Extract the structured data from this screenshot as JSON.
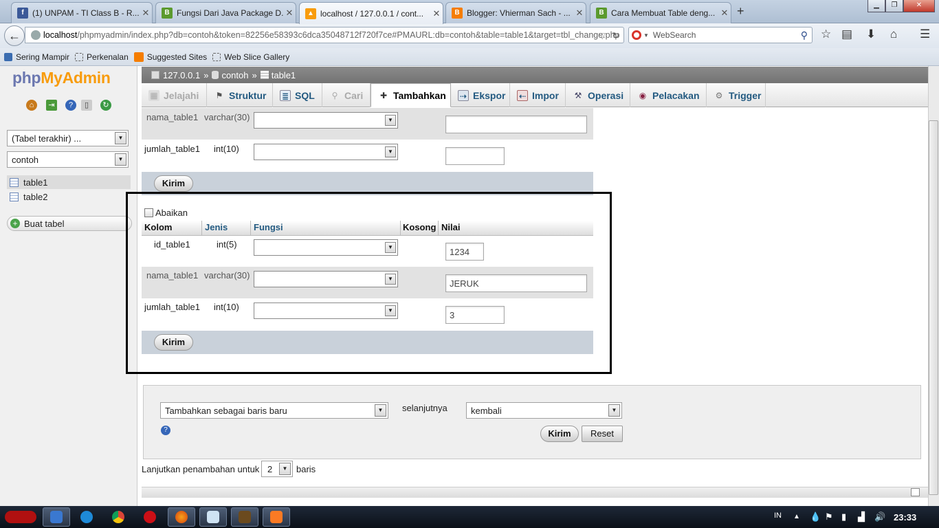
{
  "browser": {
    "tabs": [
      {
        "title": "(1) UNPAM - TI Class B - R...",
        "icon": "facebook-icon",
        "color": "#3b5998",
        "active": false
      },
      {
        "title": "Fungsi Dari Java Package D...",
        "icon": "blogspot-green-icon",
        "color": "#5b9a2e",
        "active": false
      },
      {
        "title": "localhost / 127.0.0.1 / cont...",
        "icon": "phpmyadmin-icon",
        "color": "#f89c0e",
        "active": true
      },
      {
        "title": "Blogger: Vhierman Sach - ...",
        "icon": "blogger-icon",
        "color": "#f57d00",
        "active": false
      },
      {
        "title": "Cara Membuat Table deng...",
        "icon": "blogspot-green-icon",
        "color": "#5b9a2e",
        "active": false
      }
    ],
    "url_host": "localhost",
    "url_path": "/phpmyadmin/index.php?db=contoh&token=82256e58393c6dca35048712f720f7ce#PMAURL:db=contoh&table=table1&target=tbl_change.php",
    "search_placeholder": "WebSearch",
    "bookmarks": [
      "Sering Mampir",
      "Perkenalan",
      "Suggested Sites",
      "Web Slice Gallery"
    ]
  },
  "sidebar": {
    "logo_php": "php",
    "logo_myadmin": "MyAdmin",
    "recent_select": "(Tabel terakhir) ...",
    "db_select": "contoh",
    "tables": [
      "table1",
      "table2"
    ],
    "create_table": "Buat tabel"
  },
  "breadcrumb": {
    "server": "127.0.0.1",
    "db": "contoh",
    "table": "table1",
    "sep": "»"
  },
  "menu_tabs": [
    {
      "label": "Jelajahi",
      "icon": "browse-icon",
      "state": "disabled"
    },
    {
      "label": "Struktur",
      "icon": "structure-icon",
      "state": "normal"
    },
    {
      "label": "SQL",
      "icon": "sql-icon",
      "state": "normal"
    },
    {
      "label": "Cari",
      "icon": "search-icon",
      "state": "disabled"
    },
    {
      "label": "Tambahkan",
      "icon": "insert-icon",
      "state": "active"
    },
    {
      "label": "Ekspor",
      "icon": "export-icon",
      "state": "normal"
    },
    {
      "label": "Impor",
      "icon": "import-icon",
      "state": "normal"
    },
    {
      "label": "Operasi",
      "icon": "wrench-icon",
      "state": "normal"
    },
    {
      "label": "Pelacakan",
      "icon": "eye-icon",
      "state": "normal"
    },
    {
      "label": "Trigger",
      "icon": "trigger-icon",
      "state": "normal"
    }
  ],
  "form1": {
    "rows": [
      {
        "column": "nama_table1",
        "type": "varchar(30)",
        "value": ""
      },
      {
        "column": "jumlah_table1",
        "type": "int(10)",
        "value": ""
      }
    ],
    "submit": "Kirim"
  },
  "form2": {
    "ignore_label": "Abaikan",
    "headers": {
      "kolom": "Kolom",
      "jenis": "Jenis",
      "fungsi": "Fungsi",
      "kosong": "Kosong",
      "nilai": "Nilai"
    },
    "rows": [
      {
        "column": "id_table1",
        "type": "int(5)",
        "value": "1234"
      },
      {
        "column": "nama_table1",
        "type": "varchar(30)",
        "value": "JERUK"
      },
      {
        "column": "jumlah_table1",
        "type": "int(10)",
        "value": "3"
      }
    ],
    "submit": "Kirim"
  },
  "bottom": {
    "action_select": "Tambahkan sebagai baris baru",
    "then_label": "selanjutnya",
    "then_select": "kembali",
    "submit": "Kirim",
    "reset": "Reset",
    "continue_label": "Lanjutkan penambahan untuk",
    "continue_count": "2",
    "rows_label": "baris"
  },
  "taskbar": {
    "lang": "IN",
    "time": "23:33"
  }
}
